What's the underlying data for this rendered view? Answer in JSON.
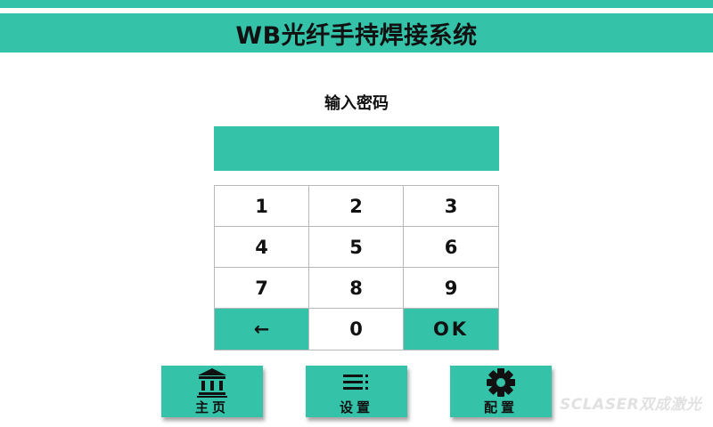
{
  "header": {
    "title": "WB光纤手持焊接系统"
  },
  "password": {
    "label": "输入密码",
    "value": ""
  },
  "keypad": {
    "keys": [
      "1",
      "2",
      "3",
      "4",
      "5",
      "6",
      "7",
      "8",
      "9",
      "←",
      "0",
      "OK"
    ]
  },
  "nav": {
    "home_label": "主页",
    "settings_label": "设置",
    "config_label": "配置"
  },
  "icons": {
    "home": "bank-icon",
    "settings": "menu-list-icon",
    "config": "gear-icon"
  },
  "watermark": "SCLASER双成激光",
  "colors": {
    "accent": "#34c2a9",
    "text": "#111111"
  }
}
